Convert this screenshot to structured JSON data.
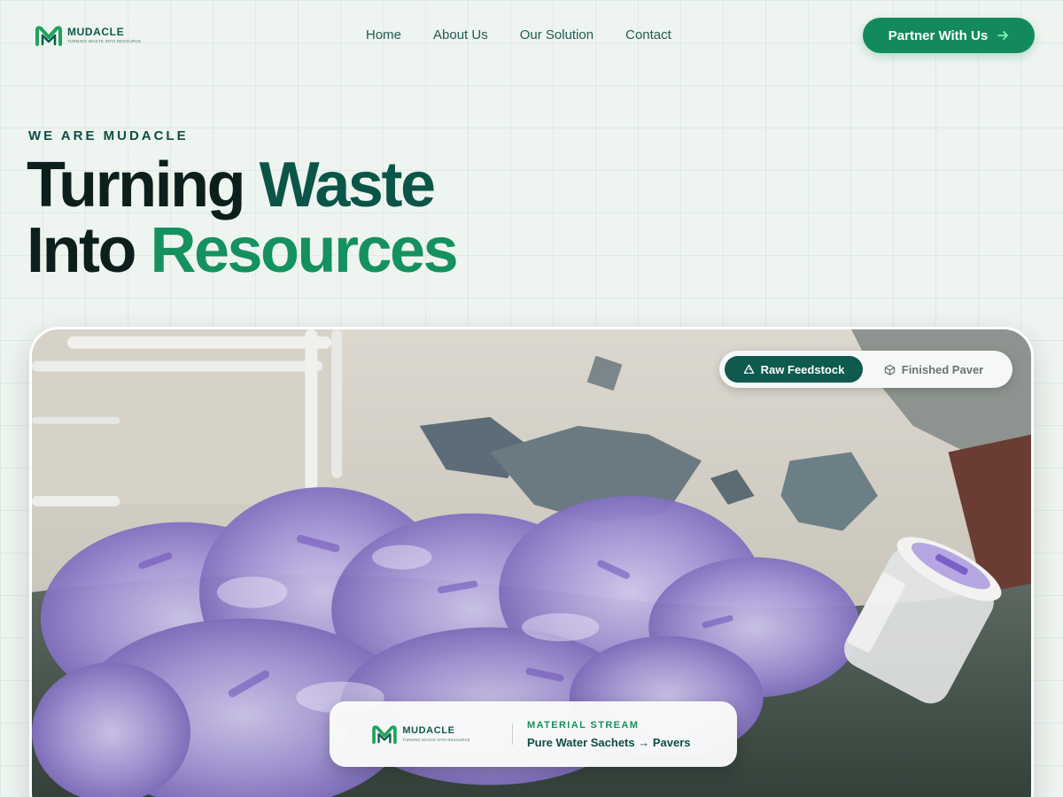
{
  "brand": {
    "name": "MUDACLE",
    "tagline": "TURNING WASTE INTO RESOURCE",
    "logo_colors": [
      "#1fa35c",
      "#0d5a4a"
    ]
  },
  "nav": {
    "items": [
      {
        "label": "Home"
      },
      {
        "label": "About Us"
      },
      {
        "label": "Our Solution"
      },
      {
        "label": "Contact"
      }
    ]
  },
  "cta": {
    "label": "Partner With Us",
    "icon": "arrow-right-icon",
    "color": "#138a5e"
  },
  "hero": {
    "eyebrow": "WE ARE MUDACLE",
    "headline": {
      "line1_part1": "Turning ",
      "line1_part2": "Waste",
      "line2_part1": "Into ",
      "line2_part2": "Resources"
    },
    "colors": {
      "text": "#0c1f1c",
      "accent_dark": "#0b5548",
      "accent_green": "#14915e"
    }
  },
  "gallery": {
    "toggle": {
      "options": [
        {
          "label": "Raw Feedstock",
          "icon": "recycle-icon",
          "active": true
        },
        {
          "label": "Finished Paver",
          "icon": "cube-icon",
          "active": false
        }
      ]
    },
    "info": {
      "label": "MATERIAL STREAM",
      "value": "Pure Water Sachets → Pavers"
    }
  }
}
